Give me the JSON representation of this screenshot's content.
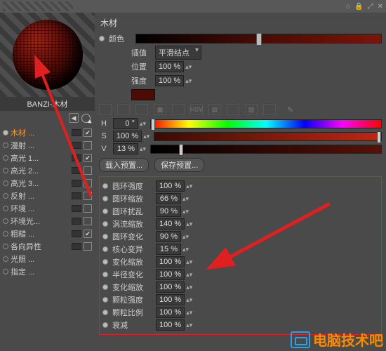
{
  "titlebar": {
    "icons": [
      "⌂",
      "🔒",
      "⤢",
      "✕"
    ]
  },
  "preview": {
    "material_name": "BANZI-木材"
  },
  "channels": [
    {
      "label": "木材 ...",
      "highlight": true,
      "swatch": true,
      "checked": true
    },
    {
      "label": "漫射 ...",
      "highlight": false,
      "swatch": true,
      "checked": false
    },
    {
      "label": "高光 1...",
      "highlight": false,
      "swatch": true,
      "checked": true
    },
    {
      "label": "高光 2...",
      "highlight": false,
      "swatch": true,
      "checked": false
    },
    {
      "label": "高光 3...",
      "highlight": false,
      "swatch": true,
      "checked": false
    },
    {
      "label": "反射 ...",
      "highlight": false,
      "swatch": true,
      "checked": false
    },
    {
      "label": "环境 ...",
      "highlight": false,
      "swatch": true,
      "checked": false
    },
    {
      "label": "环境光...",
      "highlight": false,
      "swatch": true,
      "checked": false
    },
    {
      "label": "粗糙 ...",
      "highlight": false,
      "swatch": true,
      "checked": true
    },
    {
      "label": "各向异性",
      "highlight": false,
      "swatch": true,
      "checked": false
    },
    {
      "label": "光照 ...",
      "highlight": false,
      "swatch": false,
      "checked": null
    },
    {
      "label": "指定 ...",
      "highlight": false,
      "swatch": false,
      "checked": null
    }
  ],
  "panel": {
    "title": "木材",
    "color_label": "颜色",
    "color_knob_pct": 50,
    "interp_label": "插值",
    "interp_value": "平滑结点",
    "position_label": "位置",
    "position_value": "100 %",
    "intensity_label": "强度",
    "intensity_value": "100 %"
  },
  "iconrow": [
    "",
    "",
    "",
    "▦",
    "",
    "HSV",
    "▤",
    "",
    "▨",
    ""
  ],
  "pen_icon": "✎",
  "hsv": {
    "h_label": "H",
    "h_value": "0 °",
    "h_knob": 1,
    "s_label": "S",
    "s_value": "100 %",
    "s_knob": 99,
    "v_label": "V",
    "v_value": "13 %",
    "v_knob": 13
  },
  "buttons": {
    "load": "载入预置...",
    "save": "保存预置..."
  },
  "params": [
    {
      "label": "圆环强度",
      "value": "100 %"
    },
    {
      "label": "圆环缩放",
      "value": "66 %"
    },
    {
      "label": "圆环扰乱",
      "value": "90 %"
    },
    {
      "label": "涡流缩放",
      "value": "140 %"
    },
    {
      "label": "圆环变化",
      "value": "90 %"
    },
    {
      "label": "核心变异",
      "value": "15 %"
    },
    {
      "label": "变化缩放",
      "value": "100 %"
    },
    {
      "label": "半径变化",
      "value": "100 %"
    },
    {
      "label": "变化缩放",
      "value": "100 %"
    },
    {
      "label": "颗粒强度",
      "value": "100 %"
    },
    {
      "label": "颗粒比例",
      "value": "100 %"
    },
    {
      "label": "衰减",
      "value": "100 %"
    }
  ],
  "watermark": "电脑技术吧"
}
